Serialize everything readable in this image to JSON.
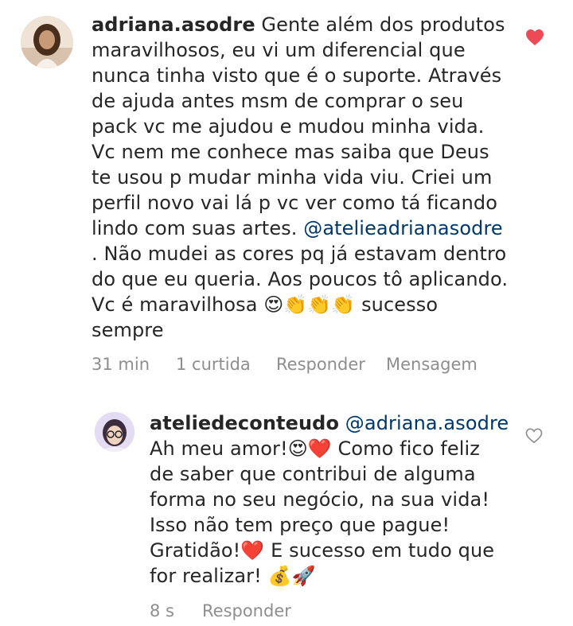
{
  "comment_main": {
    "username": "adriana.asodre",
    "lines": [
      " Gente além dos produtos",
      "maravilhosos, eu vi um diferencial que",
      "nunca tinha visto que é o suporte. Através",
      "de ajuda antes msm de comprar o seu",
      "pack vc me ajudou e mudou minha vida.",
      "Vc nem me conhece mas saiba que Deus",
      "te usou p mudar minha vida viu. Criei um",
      "perfil novo vai lá p vc ver como tá ficando",
      "lindo com suas artes. "
    ],
    "mention": "@atelieadrianasodre",
    "lines_after": [
      ". Não mudei as cores pq já estavam dentro",
      "do que eu queria. Aos poucos tô aplicando.",
      "Vc é maravilhosa 😍👏👏👏 sucesso",
      "sempre"
    ],
    "time": "31 min",
    "likes": "1 curtida",
    "reply": "Responder",
    "message": "Mensagem",
    "liked": true,
    "heart_color": "#ed4956"
  },
  "comment_reply": {
    "username": "ateliedeconteudo",
    "mention": "@adriana.asodre",
    "lines": [
      "Ah meu amor!😍❤️ Como fico feliz",
      "de saber que contribui de alguma",
      "forma no seu negócio, na sua vida!",
      "Isso não tem preço que pague!",
      "Gratidão!❤️ E sucesso em tudo que",
      "for realizar! 💰🚀"
    ],
    "time": "8 s",
    "reply": "Responder",
    "liked": false
  },
  "colors": {
    "text": "#262626",
    "meta": "#8e8e8e",
    "mention": "#00376b",
    "like": "#ed4956"
  }
}
